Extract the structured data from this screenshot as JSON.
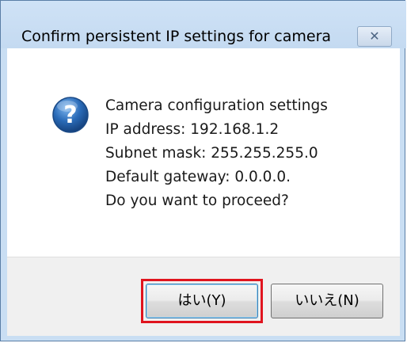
{
  "window": {
    "title": "Confirm persistent IP settings for camera",
    "close_glyph": "✕"
  },
  "message": {
    "icon": "question-icon",
    "lines": [
      "Camera configuration settings",
      "IP address: 192.168.1.2",
      "Subnet mask: 255.255.255.0",
      "Default gateway: 0.0.0.0.",
      "Do you want to proceed?"
    ]
  },
  "buttons": {
    "yes_label": "はい(Y)",
    "no_label": "いいえ(N)"
  },
  "colors": {
    "title_bar": "#c9def3",
    "highlight": "#e0141e",
    "icon_blue": "#2a6bb8"
  }
}
